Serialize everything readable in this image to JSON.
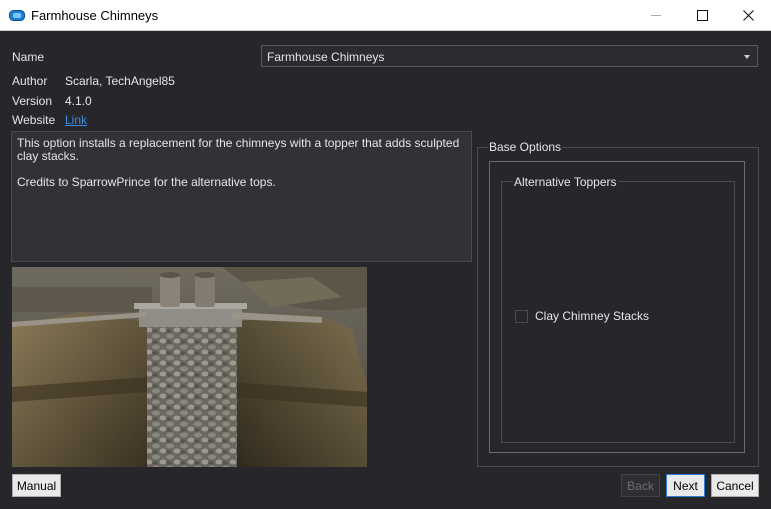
{
  "window": {
    "title": "Farmhouse Chimneys"
  },
  "form": {
    "name_label": "Name",
    "name_value": "Farmhouse Chimneys",
    "author_label": "Author",
    "author_value": "Scarla, TechAngel85",
    "version_label": "Version",
    "version_value": "4.1.0",
    "website_label": "Website",
    "website_value": "Link"
  },
  "description": {
    "paragraph1": "This option installs a replacement for the chimneys with a topper that adds sculpted clay stacks.",
    "paragraph2": "Credits to SparrowPrince for the alternative tops."
  },
  "options": {
    "group_title": "Base Options",
    "subgroup_title": "Alternative Toppers",
    "checkbox_label": "Clay Chimney Stacks",
    "checkbox_checked": false
  },
  "buttons": {
    "manual": "Manual",
    "back": "Back",
    "next": "Next",
    "cancel": "Cancel"
  },
  "icons": {
    "app": "mod-organizer-icon",
    "accent": "#2d7fd6"
  }
}
